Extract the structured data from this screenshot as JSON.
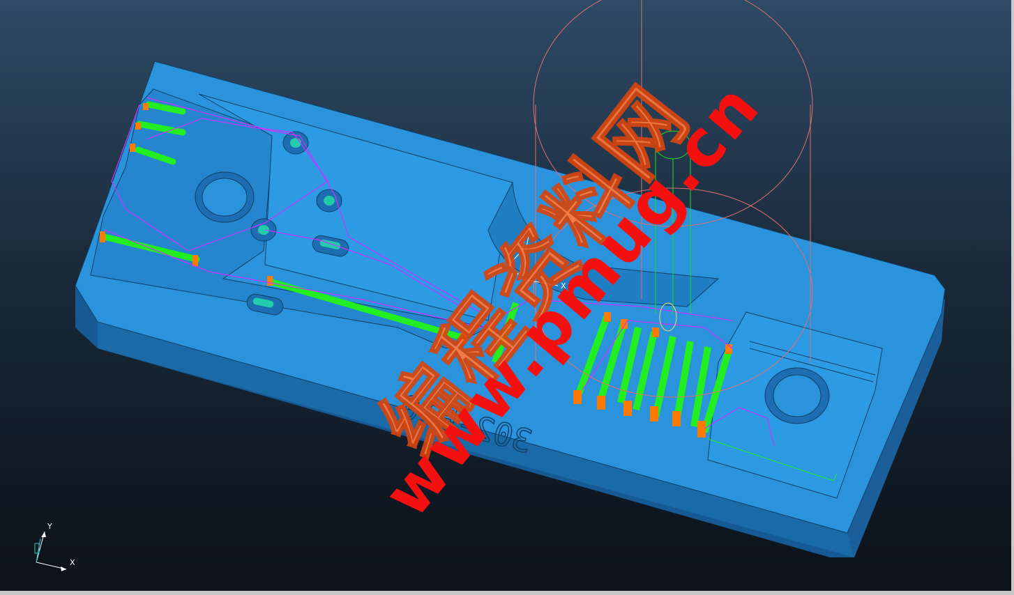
{
  "viewport": {
    "engraving": "302-E10",
    "watermark_cn": "编程资料网",
    "watermark_url": "www.pmug.cn",
    "wcs_labels": {
      "y": "Y",
      "x": "X"
    },
    "triad": {
      "y_label": "Y",
      "x_label": "X",
      "z_label": "Z"
    }
  },
  "colors": {
    "part_top": "#2b93dc",
    "part_side": "#1d6db2",
    "toolpath_green": "#22ee22",
    "toolpath_orange": "#ff7a00",
    "toolpath_magenta": "#cc33ff",
    "tool_outline": "#e07070",
    "tool_green": "#22dd22"
  }
}
